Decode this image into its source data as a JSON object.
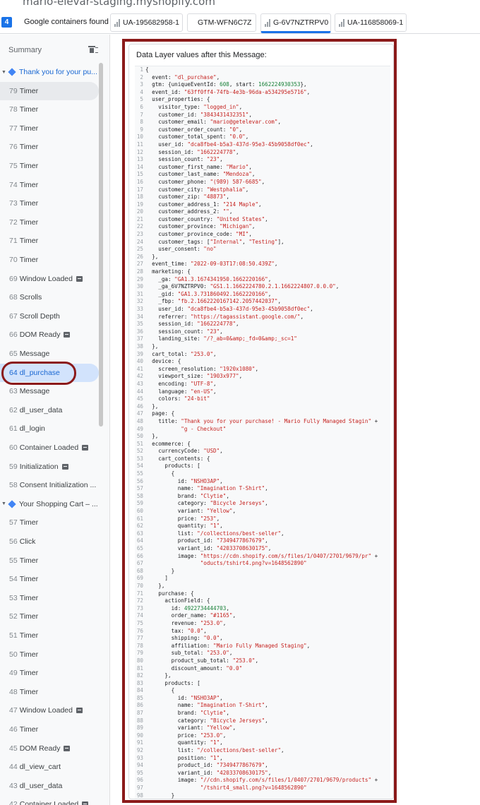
{
  "url_text": "mario-elevar-staging.myshopify.com",
  "tabbar": {
    "container_count": "4",
    "found_label": "Google containers found",
    "tabs": [
      {
        "label": "UA-195682958-1",
        "kind": "bars"
      },
      {
        "label": "GTM-WFN6C7Z",
        "kind": "diamond"
      },
      {
        "label": "G-6V7NZTRPV0",
        "kind": "bars"
      },
      {
        "label": "UA-116858069-1",
        "kind": "bars"
      }
    ]
  },
  "sidebar": {
    "summary_label": "Summary",
    "items": [
      {
        "type": "group",
        "label": "Thank you for your pu..."
      },
      {
        "type": "item",
        "num": "79",
        "label": "Timer",
        "state": "hover"
      },
      {
        "type": "item",
        "num": "78",
        "label": "Timer"
      },
      {
        "type": "item",
        "num": "77",
        "label": "Timer"
      },
      {
        "type": "item",
        "num": "76",
        "label": "Timer"
      },
      {
        "type": "item",
        "num": "75",
        "label": "Timer"
      },
      {
        "type": "item",
        "num": "74",
        "label": "Timer"
      },
      {
        "type": "item",
        "num": "73",
        "label": "Timer"
      },
      {
        "type": "item",
        "num": "72",
        "label": "Timer"
      },
      {
        "type": "item",
        "num": "71",
        "label": "Timer"
      },
      {
        "type": "item",
        "num": "70",
        "label": "Timer"
      },
      {
        "type": "item",
        "num": "69",
        "label": "Window Loaded",
        "icon": true
      },
      {
        "type": "item",
        "num": "68",
        "label": "Scrolls"
      },
      {
        "type": "item",
        "num": "67",
        "label": "Scroll Depth"
      },
      {
        "type": "item",
        "num": "66",
        "label": "DOM Ready",
        "icon": true
      },
      {
        "type": "item",
        "num": "65",
        "label": "Message"
      },
      {
        "type": "item",
        "num": "64",
        "label": "dl_purchase",
        "state": "selected"
      },
      {
        "type": "item",
        "num": "63",
        "label": "Message"
      },
      {
        "type": "item",
        "num": "62",
        "label": "dl_user_data"
      },
      {
        "type": "item",
        "num": "61",
        "label": "dl_login"
      },
      {
        "type": "item",
        "num": "60",
        "label": "Container Loaded",
        "icon": true
      },
      {
        "type": "item",
        "num": "59",
        "label": "Initialization",
        "icon": true
      },
      {
        "type": "item",
        "num": "58",
        "label": "Consent Initialization ..."
      },
      {
        "type": "group",
        "label": "Your Shopping Cart – ...",
        "dark": true
      },
      {
        "type": "item",
        "num": "57",
        "label": "Timer"
      },
      {
        "type": "item",
        "num": "56",
        "label": "Click"
      },
      {
        "type": "item",
        "num": "55",
        "label": "Timer"
      },
      {
        "type": "item",
        "num": "54",
        "label": "Timer"
      },
      {
        "type": "item",
        "num": "53",
        "label": "Timer"
      },
      {
        "type": "item",
        "num": "52",
        "label": "Timer"
      },
      {
        "type": "item",
        "num": "51",
        "label": "Timer"
      },
      {
        "type": "item",
        "num": "50",
        "label": "Timer"
      },
      {
        "type": "item",
        "num": "49",
        "label": "Timer"
      },
      {
        "type": "item",
        "num": "48",
        "label": "Timer"
      },
      {
        "type": "item",
        "num": "47",
        "label": "Window Loaded",
        "icon": true
      },
      {
        "type": "item",
        "num": "46",
        "label": "Timer"
      },
      {
        "type": "item",
        "num": "45",
        "label": "DOM Ready",
        "icon": true
      },
      {
        "type": "item",
        "num": "44",
        "label": "dl_view_cart"
      },
      {
        "type": "item",
        "num": "43",
        "label": "dl_user_data"
      },
      {
        "type": "item",
        "num": "42",
        "label": "Container Loaded",
        "icon": true
      }
    ]
  },
  "panel": {
    "title": "Data Layer values after this Message:",
    "code_lines": [
      "{",
      "  event: \"dl_purchase\",",
      "  gtm: {uniqueEventId: 608, start: 1662224930353},",
      "  event_id: \"63ff0ff4-74fb-4e3b-96da-a534295e5716\",",
      "  user_properties: {",
      "    visitor_type: \"logged_in\",",
      "    customer_id: \"3843431432351\",",
      "    customer_email: \"mario@getelevar.com\",",
      "    customer_order_count: \"0\",",
      "    customer_total_spent: \"0.0\",",
      "    user_id: \"dca8fbe4-b5a3-437d-95e3-45b9058df0ec\",",
      "    session_id: \"1662224778\",",
      "    session_count: \"23\",",
      "    customer_first_name: \"Mario\",",
      "    customer_last_name: \"Mendoza\",",
      "    customer_phone: \"(989) 587-6685\",",
      "    customer_city: \"Westphalia\",",
      "    customer_zip: \"48873\",",
      "    customer_address_1: \"214 Maple\",",
      "    customer_address_2: \"\",",
      "    customer_country: \"United States\",",
      "    customer_province: \"Michigan\",",
      "    customer_province_code: \"MI\",",
      "    customer_tags: [\"Internal\", \"Testing\"],",
      "    user_consent: \"no\"",
      "  },",
      "  event_time: \"2022-09-03T17:08:50.439Z\",",
      "  marketing: {",
      "    _ga: \"GA1.3.1674341950.1662220166\",",
      "    _ga_6V7NZTRPV0: \"GS1.1.1662224780.2.1.1662224807.0.0.0\",",
      "    _gid: \"GA1.3.731860492.1662220166\",",
      "    _fbp: \"fb.2.1662220167142.2057442037\",",
      "    user_id: \"dca8fbe4-b5a3-437d-95e3-45b9058df0ec\",",
      "    referrer: \"https://tagassistant.google.com/\",",
      "    session_id: \"1662224778\",",
      "    session_count: \"23\",",
      "    landing_site: \"/?_ab=0&amp;_fd=0&amp;_sc=1\"",
      "  },",
      "  cart_total: \"253.0\",",
      "  device: {",
      "    screen_resolution: \"1920x1080\",",
      "    viewport_size: \"1903x977\",",
      "    encoding: \"UTF-8\",",
      "    language: \"en-US\",",
      "    colors: \"24-bit\"",
      "  },",
      "  page: {",
      "    title: \"Thank you for your purchase! - Mario Fully Managed Stagin\" +",
      "           \"g - Checkout\"",
      "  },",
      "  ecommerce: {",
      "    currencyCode: \"USD\",",
      "    cart_contents: {",
      "      products: [",
      "        {",
      "          id: \"NSHO3AP\",",
      "          name: \"Imagination T-Shirt\",",
      "          brand: \"Clytie\",",
      "          category: \"Bicycle Jerseys\",",
      "          variant: \"Yellow\",",
      "          price: \"253\",",
      "          quantity: \"1\",",
      "          list: \"/collections/best-seller\",",
      "          product_id: \"7349477867679\",",
      "          variant_id: \"42033708630175\",",
      "          image: \"https://cdn.shopify.com/s/files/1/0407/2701/9679/pr\" +",
      "                 \"oducts/tshirt4.png?v=1648562890\"",
      "        }",
      "      ]",
      "    },",
      "    purchase: {",
      "      actionField: {",
      "        id: 4922734444703,",
      "        order_name: \"#1165\",",
      "        revenue: \"253.0\",",
      "        tax: \"0.0\",",
      "        shipping: \"0.0\",",
      "        affiliation: \"Mario Fully Managed Staging\",",
      "        sub_total: \"253.0\",",
      "        product_sub_total: \"253.0\",",
      "        discount_amount: \"0.0\"",
      "      },",
      "      products: [",
      "        {",
      "          id: \"NSHO3AP\",",
      "          name: \"Imagination T-Shirt\",",
      "          brand: \"Clytie\",",
      "          category: \"Bicycle Jerseys\",",
      "          variant: \"Yellow\",",
      "          price: \"253.0\",",
      "          quantity: \"1\",",
      "          list: \"/collections/best-seller\",",
      "          position: \"1\",",
      "          product_id: \"7349477867679\",",
      "          variant_id: \"42033708630175\",",
      "          image: \"//cdn.shopify.com/s/files/1/0407/2701/9679/products\" +",
      "                 \"/tshirt4_small.png?v=1648562890\"",
      "        }",
      "      ]"
    ]
  },
  "colors": {
    "accent": "#1a73e8",
    "annotation": "#8b1a1a",
    "string": "#c5221f",
    "number": "#188038"
  }
}
